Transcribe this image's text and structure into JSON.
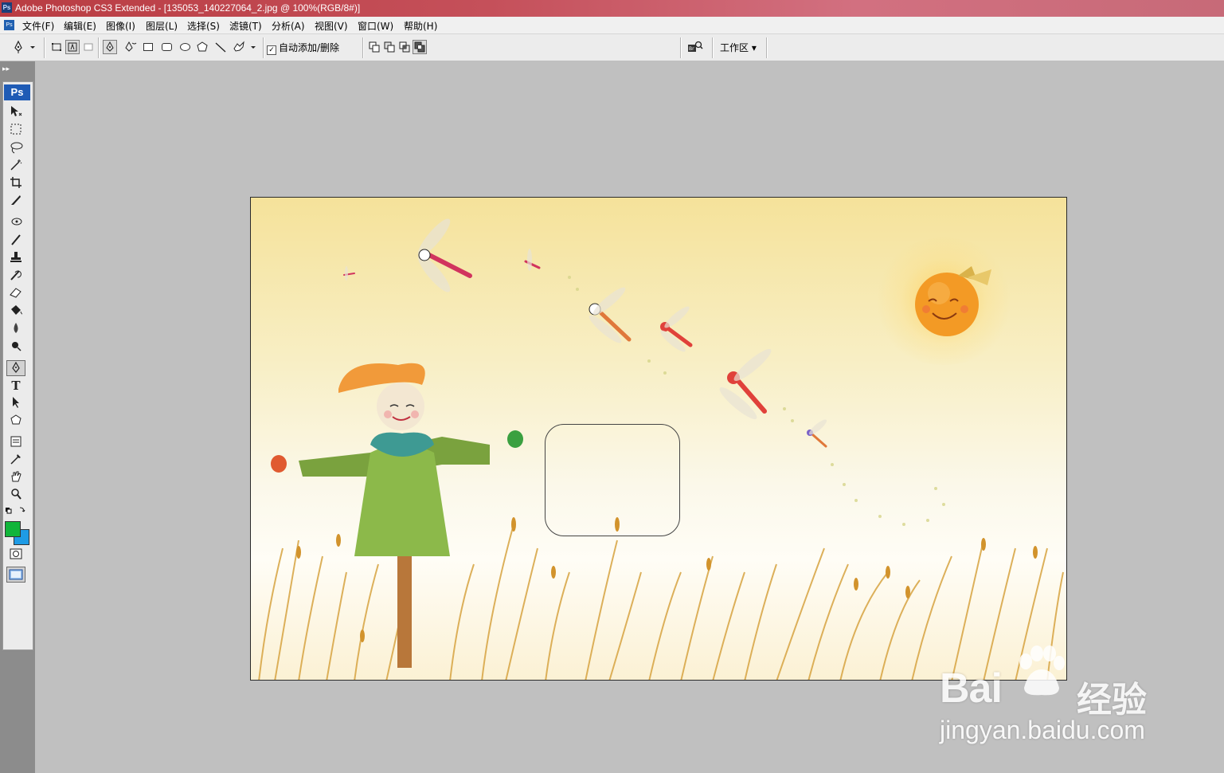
{
  "window": {
    "title": "Adobe Photoshop CS3 Extended - [135053_140227064_2.jpg @ 100%(RGB/8#)]",
    "app_icon": "Ps"
  },
  "menubar": {
    "doc_icon": "Ps",
    "items": [
      "文件(F)",
      "编辑(E)",
      "图像(I)",
      "图层(L)",
      "选择(S)",
      "滤镜(T)",
      "分析(A)",
      "视图(V)",
      "窗口(W)",
      "帮助(H)"
    ]
  },
  "options": {
    "auto_add_delete_label": "自动添加/删除",
    "auto_add_delete_checked": true,
    "workspace_label": "工作区 ▾"
  },
  "toolbox": {
    "logo": "Ps",
    "selected_tool": "pen-tool",
    "foreground_color": "#11b53a",
    "background_color": "#1e9be5"
  },
  "canvas": {
    "artwork": "scarecrow with dragonflies, sun and wheat field"
  },
  "watermark": {
    "logo_text": "Bai",
    "logo_suffix": "经验",
    "url": "jingyan.baidu.com"
  }
}
